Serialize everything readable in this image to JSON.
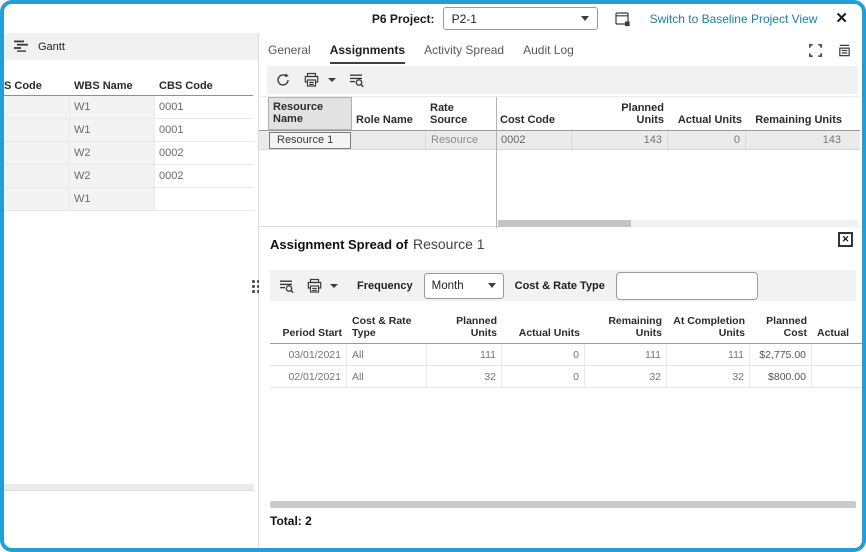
{
  "colors": {
    "window_border": "#239fd8",
    "link": "#1f7e9f",
    "toolbar_bg": "#f1f1f1"
  },
  "topbar": {
    "project_label": "P6 Project:",
    "project_value": "P2-1",
    "baseline_link": "Switch to Baseline Project View",
    "close": "✕"
  },
  "left_panel": {
    "title": "Gantt",
    "grid": {
      "headers": [
        "S Code",
        "WBS Name",
        "CBS Code"
      ],
      "rows": [
        [
          "",
          "W1",
          "0001"
        ],
        [
          "",
          "W1",
          "0001"
        ],
        [
          "",
          "W2",
          "0002"
        ],
        [
          "",
          "W2",
          "0002"
        ],
        [
          "",
          "W1",
          ""
        ]
      ]
    }
  },
  "tabs": {
    "items": [
      {
        "label": "General"
      },
      {
        "label": "Assignments"
      },
      {
        "label": "Activity Spread"
      },
      {
        "label": "Audit Log"
      }
    ]
  },
  "resource_grid": {
    "headers": [
      "Resource\nName",
      "Role Name",
      "Rate Source",
      "Cost Code",
      "Planned\nUnits",
      "Actual Units",
      "Remaining Units"
    ],
    "row": [
      "Resource 1",
      "",
      "Resource",
      "0002",
      "143",
      "0",
      "143"
    ]
  },
  "spread": {
    "title_prefix": "Assignment Spread of",
    "title_resource": "Resource 1",
    "close": "✕",
    "frequency_label": "Frequency",
    "frequency_value": "Month",
    "cost_rate_label": "Cost & Rate Type",
    "cost_rate_value": "",
    "grid": {
      "headers": [
        "Period Start",
        "Cost & Rate Type",
        "Planned Units",
        "Actual Units",
        "Remaining\nUnits",
        "At Completion\nUnits",
        "Planned\nCost",
        "Actual"
      ],
      "rows": [
        [
          "03/01/2021",
          "All",
          "111",
          "0",
          "111",
          "111",
          "$2,775.00",
          ""
        ],
        [
          "02/01/2021",
          "All",
          "32",
          "0",
          "32",
          "32",
          "$800.00",
          ""
        ]
      ]
    },
    "total": "Total: 2"
  }
}
